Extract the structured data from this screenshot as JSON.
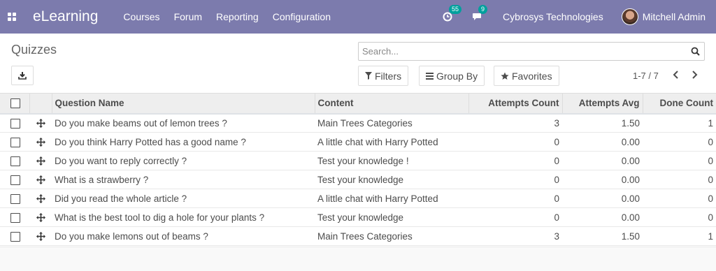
{
  "navbar": {
    "brand": "eLearning",
    "menu": [
      "Courses",
      "Forum",
      "Reporting",
      "Configuration"
    ],
    "activity_badge": "55",
    "messages_badge": "9",
    "company": "Cybrosys Technologies",
    "user": "Mitchell Admin"
  },
  "control_panel": {
    "title": "Quizzes",
    "search_placeholder": "Search...",
    "filters_label": "Filters",
    "groupby_label": "Group By",
    "favorites_label": "Favorites",
    "pager": "1-7 / 7"
  },
  "table": {
    "columns": [
      "Question Name",
      "Content",
      "Attempts Count",
      "Attempts Avg",
      "Done Count"
    ],
    "rows": [
      {
        "name": "Do you make beams out of lemon trees ?",
        "content": "Main Trees Categories",
        "attempts_count": "3",
        "attempts_avg": "1.50",
        "done_count": "1"
      },
      {
        "name": "Do you think Harry Potted has a good name ?",
        "content": "A little chat with Harry Potted",
        "attempts_count": "0",
        "attempts_avg": "0.00",
        "done_count": "0"
      },
      {
        "name": "Do you want to reply correctly ?",
        "content": "Test your knowledge !",
        "attempts_count": "0",
        "attempts_avg": "0.00",
        "done_count": "0"
      },
      {
        "name": "What is a strawberry ?",
        "content": "Test your knowledge",
        "attempts_count": "0",
        "attempts_avg": "0.00",
        "done_count": "0"
      },
      {
        "name": "Did you read the whole article ?",
        "content": "A little chat with Harry Potted",
        "attempts_count": "0",
        "attempts_avg": "0.00",
        "done_count": "0"
      },
      {
        "name": "What is the best tool to dig a hole for your plants ?",
        "content": "Test your knowledge",
        "attempts_count": "0",
        "attempts_avg": "0.00",
        "done_count": "0"
      },
      {
        "name": "Do you make lemons out of beams ?",
        "content": "Main Trees Categories",
        "attempts_count": "3",
        "attempts_avg": "1.50",
        "done_count": "1"
      }
    ]
  },
  "colors": {
    "navbar": "#7c7bad",
    "badge": "#00a09d"
  },
  "icons": [
    "apps-grid-icon",
    "activity-clock-icon",
    "messages-icon",
    "download-icon",
    "search-icon",
    "filter-icon",
    "group-by-icon",
    "star-icon",
    "chevron-left-icon",
    "chevron-right-icon",
    "drag-handle-icon"
  ]
}
